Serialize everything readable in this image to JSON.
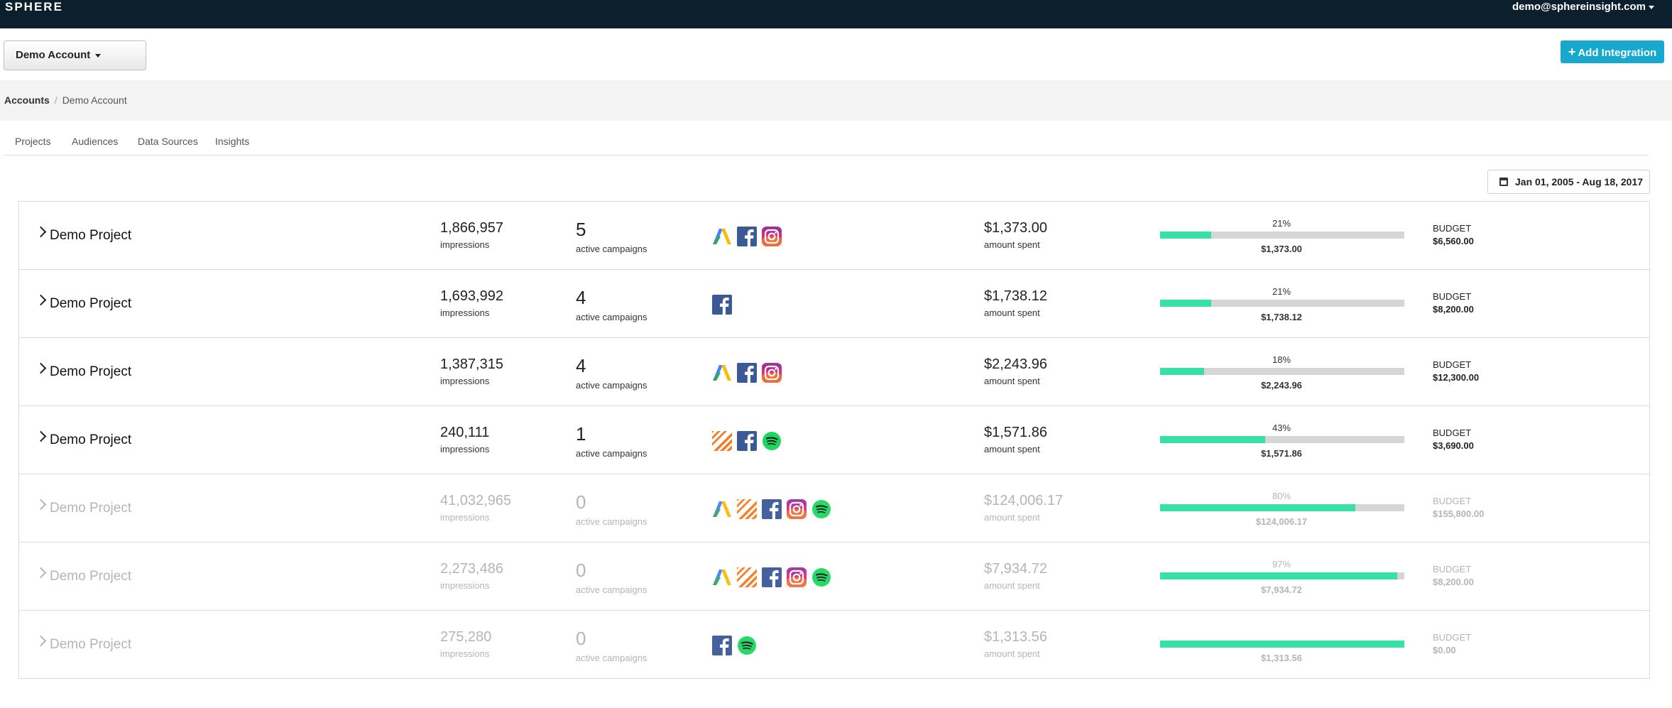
{
  "header": {
    "logo": "SPHERE",
    "user_email": "demo@sphereinsight.com"
  },
  "account_selector": {
    "label": "Demo Account"
  },
  "add_integration": {
    "plus": "+",
    "label": "Add Integration"
  },
  "breadcrumb": {
    "root": "Accounts",
    "separator": "/",
    "current": "Demo Account"
  },
  "tabs": [
    {
      "label": "Projects"
    },
    {
      "label": "Audiences"
    },
    {
      "label": "Data Sources"
    },
    {
      "label": "Insights"
    }
  ],
  "date_range": {
    "label": "Jan 01, 2005 - Aug 18, 2017"
  },
  "labels": {
    "impressions": "impressions",
    "active_campaigns": "active campaigns",
    "amount_spent": "amount spent",
    "budget": "BUDGET"
  },
  "integration_colors": {
    "adwords_blue": "#4285f4",
    "adwords_green": "#34a853",
    "adwords_yellow": "#fbbc05",
    "facebook": "#3b5998",
    "instagram_start": "#f58529",
    "instagram_mid": "#dd2a7b",
    "instagram_end": "#8134af",
    "spotify": "#1ed760",
    "appnexus": "#f47b20",
    "progress_fill": "#37e0a5"
  },
  "projects": [
    {
      "name": "Demo Project",
      "active": true,
      "impressions": "1,866,957",
      "campaigns": "5",
      "integrations": [
        "adwords-icon",
        "facebook-icon",
        "instagram-icon"
      ],
      "amount_spent": "$1,373.00",
      "percent_label": "21%",
      "percent": 21,
      "budget": "$6,560.00"
    },
    {
      "name": "Demo Project",
      "active": true,
      "impressions": "1,693,992",
      "campaigns": "4",
      "integrations": [
        "facebook-icon"
      ],
      "amount_spent": "$1,738.12",
      "percent_label": "21%",
      "percent": 21,
      "budget": "$8,200.00"
    },
    {
      "name": "Demo Project",
      "active": true,
      "impressions": "1,387,315",
      "campaigns": "4",
      "integrations": [
        "adwords-icon",
        "facebook-icon",
        "instagram-icon"
      ],
      "amount_spent": "$2,243.96",
      "percent_label": "18%",
      "percent": 18,
      "budget": "$12,300.00"
    },
    {
      "name": "Demo Project",
      "active": true,
      "impressions": "240,111",
      "campaigns": "1",
      "integrations": [
        "appnexus-icon",
        "facebook-icon",
        "spotify-icon"
      ],
      "amount_spent": "$1,571.86",
      "percent_label": "43%",
      "percent": 43,
      "budget": "$3,690.00"
    },
    {
      "name": "Demo Project",
      "active": false,
      "impressions": "41,032,965",
      "campaigns": "0",
      "integrations": [
        "adwords-icon",
        "appnexus-icon",
        "facebook-icon",
        "instagram-icon",
        "spotify-icon"
      ],
      "amount_spent": "$124,006.17",
      "percent_label": "80%",
      "percent": 80,
      "budget": "$155,800.00"
    },
    {
      "name": "Demo Project",
      "active": false,
      "impressions": "2,273,486",
      "campaigns": "0",
      "integrations": [
        "adwords-icon",
        "appnexus-icon",
        "facebook-icon",
        "instagram-icon",
        "spotify-icon"
      ],
      "amount_spent": "$7,934.72",
      "percent_label": "97%",
      "percent": 97,
      "budget": "$8,200.00"
    },
    {
      "name": "Demo Project",
      "active": false,
      "impressions": "275,280",
      "campaigns": "0",
      "integrations": [
        "facebook-icon",
        "spotify-icon"
      ],
      "amount_spent": "$1,313.56",
      "percent_label": "",
      "percent": 100,
      "budget": "$0.00"
    }
  ]
}
